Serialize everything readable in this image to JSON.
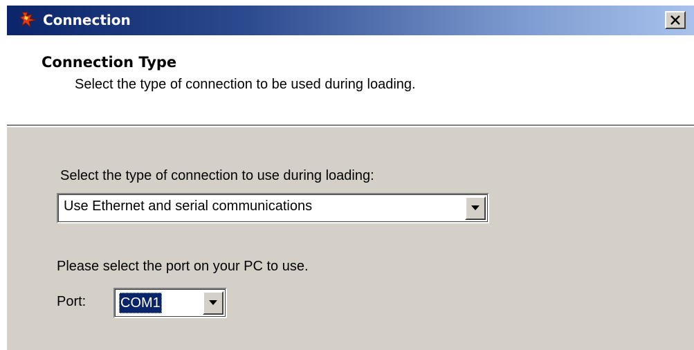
{
  "window": {
    "title": "Connection",
    "close_label": "Close"
  },
  "header": {
    "title": "Connection Type",
    "subtitle": "Select the type of connection to be used during loading."
  },
  "body": {
    "connection_type_label": "Select the type of connection to use during loading:",
    "connection_type_value": "Use Ethernet and serial communications",
    "port_instruction": "Please select the port on your PC to use.",
    "port_label": "Port:",
    "port_value": "COM1"
  },
  "colors": {
    "titlebar_start": "#0b246a",
    "titlebar_end": "#a8c2ec",
    "dialog_face": "#d4d0c8",
    "selection": "#0a246a"
  },
  "icons": {
    "app": "app-logo-icon",
    "close": "close-icon",
    "dropdown": "chevron-down-icon"
  }
}
